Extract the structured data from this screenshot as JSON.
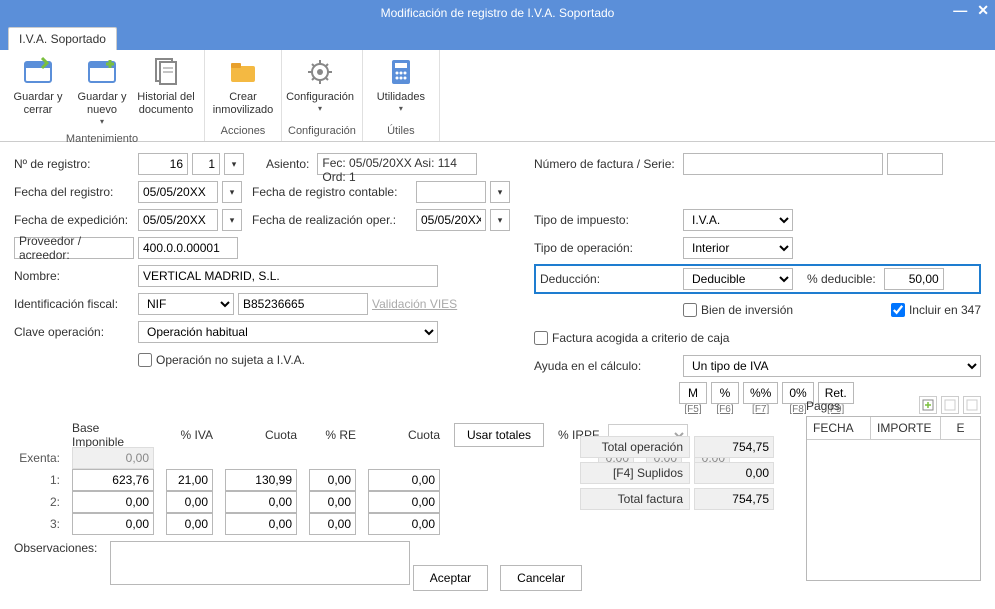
{
  "window": {
    "title": "Modificación de registro de I.V.A. Soportado"
  },
  "tab": {
    "label": "I.V.A. Soportado"
  },
  "ribbon": {
    "guardar_cerrar": "Guardar y cerrar",
    "guardar_nuevo": "Guardar y nuevo",
    "historial": "Historial del documento",
    "crear_inmov": "Crear inmovilizado",
    "configuracion": "Configuración",
    "utilidades": "Utilidades",
    "grp_mantenimiento": "Mantenimiento",
    "grp_acciones": "Acciones",
    "grp_config": "Configuración",
    "grp_utiles": "Útiles"
  },
  "left": {
    "n_registro_lbl": "Nº de registro:",
    "n_registro": "16",
    "n_registro_sub": "1",
    "asiento_lbl": "Asiento:",
    "asiento_val": "Fec: 05/05/20XX Asi: 114 Ord: 1",
    "fecha_registro_lbl": "Fecha del registro:",
    "fecha_registro": "05/05/20XX",
    "fecha_reg_cont_lbl": "Fecha de registro contable:",
    "fecha_reg_cont": "",
    "fecha_exped_lbl": "Fecha de expedición:",
    "fecha_exped": "05/05/20XX",
    "fecha_real_lbl": "Fecha de realización oper.:",
    "fecha_real": "05/05/20XX",
    "proveedor_lbl": "Proveedor / acreedor:",
    "proveedor": "400.0.0.00001",
    "nombre_lbl": "Nombre:",
    "nombre": "VERTICAL MADRID, S.L.",
    "id_fiscal_lbl": "Identificación fiscal:",
    "id_fiscal_tipo": "NIF",
    "id_fiscal_num": "B85236665",
    "validacion_vies": "Validación VIES",
    "clave_op_lbl": "Clave operación:",
    "clave_op": "Operación habitual",
    "op_no_sujeta": "Operación no sujeta a I.V.A."
  },
  "right": {
    "num_factura_lbl": "Número de factura / Serie:",
    "num_factura": "",
    "serie": "",
    "tipo_imp_lbl": "Tipo de impuesto:",
    "tipo_imp": "I.V.A.",
    "tipo_op_lbl": "Tipo de operación:",
    "tipo_op": "Interior",
    "deduccion_lbl": "Deducción:",
    "deduccion": "Deducible",
    "pct_deducible_lbl": "% deducible:",
    "pct_deducible": "50,00",
    "bien_inversion": "Bien de inversión",
    "incluir_347": "Incluir en 347",
    "factura_caja": "Factura acogida a criterio de caja",
    "ayuda_calc_lbl": "Ayuda en el cálculo:",
    "ayuda_calc": "Un tipo de IVA",
    "btn_m": "M",
    "btn_pct": "%",
    "btn_pctpct": "%%",
    "btn_0pct": "0%",
    "btn_ret": "Ret.",
    "k_f5": "[F5]",
    "k_f6": "[F6]",
    "k_f7": "[F7]",
    "k_f8": "[F8]",
    "k_f9": "[F9]"
  },
  "grid": {
    "h_base": "Base Imponible",
    "h_pct_iva": "% IVA",
    "h_cuota": "Cuota",
    "h_pct_re": "% RE",
    "h_cuota2": "Cuota",
    "usar_totales": "Usar totales",
    "h_pct_irpf": "% IRPF",
    "exenta_lbl": "Exenta:",
    "r1_lbl": "1:",
    "r2_lbl": "2:",
    "r3_lbl": "3:",
    "exenta": {
      "base": "0,00"
    },
    "r1": {
      "base": "623,76",
      "piva": "21,00",
      "cuota": "130,99",
      "pre": "0,00",
      "cuota2": "0,00"
    },
    "r2": {
      "base": "0,00",
      "piva": "0,00",
      "cuota": "0,00",
      "pre": "0,00",
      "cuota2": "0,00"
    },
    "r3": {
      "base": "0,00",
      "piva": "0,00",
      "cuota": "0,00",
      "pre": "0,00",
      "cuota2": "0,00"
    },
    "irpf_a": "0,00",
    "irpf_b": "0,00",
    "irpf_c": "0,00"
  },
  "totals": {
    "tot_op_lbl": "Total operación",
    "tot_op": "754,75",
    "suplidos_lbl": "[F4] Suplidos",
    "suplidos": "0,00",
    "tot_fac_lbl": "Total factura",
    "tot_fac": "754,75"
  },
  "pagos": {
    "title": "Pagos",
    "col_fecha": "FECHA",
    "col_importe": "IMPORTE",
    "col_e": "E"
  },
  "obs": {
    "lbl": "Observaciones:"
  },
  "actions": {
    "aceptar": "Aceptar",
    "cancelar": "Cancelar"
  }
}
